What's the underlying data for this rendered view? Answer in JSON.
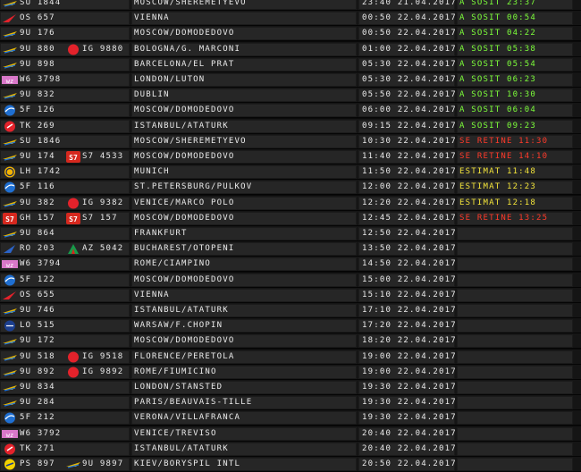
{
  "colors": {
    "green": "#7dff3a",
    "red": "#ff3a2a",
    "yellow": "#f3e43a",
    "text": "#eaeaea"
  },
  "flights": [
    {
      "logo": "airline-wing-logo",
      "code": "SU 1844",
      "share_logo": "",
      "share": "",
      "dest": "MOSCOW/SHEREMETYEVO",
      "time": "23:40",
      "date": "21.04.2017",
      "status": "A SOSIT 23:37",
      "status_color": "green"
    },
    {
      "logo": "airline-red-arrow-logo",
      "code": "OS 657",
      "share_logo": "",
      "share": "",
      "dest": "VIENNA",
      "time": "00:50",
      "date": "22.04.2017",
      "status": "A SOSIT 00:54",
      "status_color": "green"
    },
    {
      "logo": "airline-wing-logo",
      "code": "9U 176",
      "share_logo": "",
      "share": "",
      "dest": "MOSCOW/DOMODEDOVO",
      "time": "00:50",
      "date": "22.04.2017",
      "status": "A SOSIT 04:22",
      "status_color": "green"
    },
    {
      "logo": "airline-wing-logo",
      "code": "9U 880",
      "share_logo": "red-circle-logo",
      "share": "IG 9880",
      "dest": "BOLOGNA/G. MARCONI",
      "time": "01:00",
      "date": "22.04.2017",
      "status": "A SOSIT 05:38",
      "status_color": "green"
    },
    {
      "logo": "airline-wing-logo",
      "code": "9U 898",
      "share_logo": "",
      "share": "",
      "dest": "BARCELONA/EL PRAT",
      "time": "05:30",
      "date": "22.04.2017",
      "status": "A SOSIT 05:54",
      "status_color": "green"
    },
    {
      "logo": "airline-pink-logo",
      "code": "W6 3798",
      "share_logo": "",
      "share": "",
      "dest": "LONDON/LUTON",
      "time": "05:30",
      "date": "22.04.2017",
      "status": "A SOSIT 06:23",
      "status_color": "green"
    },
    {
      "logo": "airline-wing-logo",
      "code": "9U 832",
      "share_logo": "",
      "share": "",
      "dest": "DUBLIN",
      "time": "05:50",
      "date": "22.04.2017",
      "status": "A SOSIT 10:30",
      "status_color": "green"
    },
    {
      "logo": "airline-globe-logo",
      "code": "5F 126",
      "share_logo": "",
      "share": "",
      "dest": "MOSCOW/DOMODEDOVO",
      "time": "06:00",
      "date": "22.04.2017",
      "status": "A SOSIT 06:04",
      "status_color": "green"
    },
    {
      "logo": "airline-turkish-logo",
      "code": "TK 269",
      "share_logo": "",
      "share": "",
      "dest": "ISTANBUL/ATATURK",
      "time": "09:15",
      "date": "22.04.2017",
      "status": "A SOSIT 09:23",
      "status_color": "green"
    },
    {
      "logo": "airline-wing-logo",
      "code": "SU 1846",
      "share_logo": "",
      "share": "",
      "dest": "MOSCOW/SHEREMETYEVO",
      "time": "10:30",
      "date": "22.04.2017",
      "status": "SE RETINE 11:30",
      "status_color": "red"
    },
    {
      "logo": "airline-wing-logo",
      "code": "9U 174",
      "share_logo": "s7-logo",
      "share": "S7 4533",
      "dest": "MOSCOW/DOMODEDOVO",
      "time": "11:40",
      "date": "22.04.2017",
      "status": "SE RETINE 14:10",
      "status_color": "red"
    },
    {
      "logo": "airline-ring-logo",
      "code": "LH 1742",
      "share_logo": "",
      "share": "",
      "dest": "MUNICH",
      "time": "11:50",
      "date": "22.04.2017",
      "status": "ESTIMAT 11:48",
      "status_color": "yellow"
    },
    {
      "logo": "airline-globe-logo",
      "code": "5F 116",
      "share_logo": "",
      "share": "",
      "dest": "ST.PETERSBURG/PULKOV",
      "time": "12:00",
      "date": "22.04.2017",
      "status": "ESTIMAT 12:23",
      "status_color": "yellow"
    },
    {
      "logo": "airline-wing-logo",
      "code": "9U 382",
      "share_logo": "red-circle-logo",
      "share": "IG 9382",
      "dest": "VENICE/MARCO POLO",
      "time": "12:20",
      "date": "22.04.2017",
      "status": "ESTIMAT 12:18",
      "status_color": "yellow"
    },
    {
      "logo": "s7-logo",
      "code": "GH 157",
      "share_logo": "s7-logo",
      "share": "S7 157",
      "dest": "MOSCOW/DOMODEDOVO",
      "time": "12:45",
      "date": "22.04.2017",
      "status": "SE RETINE 13:25",
      "status_color": "red"
    },
    {
      "logo": "airline-wing-logo",
      "code": "9U 864",
      "share_logo": "",
      "share": "",
      "dest": "FRANKFURT",
      "time": "12:50",
      "date": "22.04.2017",
      "status": "",
      "status_color": "green"
    },
    {
      "logo": "airline-tarom-logo",
      "code": "RO 203",
      "share_logo": "alitalia-logo",
      "share": "AZ 5042",
      "dest": "BUCHAREST/OTOPENI",
      "time": "13:50",
      "date": "22.04.2017",
      "status": "",
      "status_color": "green"
    },
    {
      "logo": "airline-pink-logo",
      "code": "W6 3794",
      "share_logo": "",
      "share": "",
      "dest": "ROME/CIAMPINO",
      "time": "14:50",
      "date": "22.04.2017",
      "status": "",
      "status_color": "green"
    },
    {
      "logo": "airline-globe-logo",
      "code": "5F 122",
      "share_logo": "",
      "share": "",
      "dest": "MOSCOW/DOMODEDOVO",
      "time": "15:00",
      "date": "22.04.2017",
      "status": "",
      "status_color": "green"
    },
    {
      "logo": "airline-red-arrow-logo",
      "code": "OS 655",
      "share_logo": "",
      "share": "",
      "dest": "VIENNA",
      "time": "15:10",
      "date": "22.04.2017",
      "status": "",
      "status_color": "green"
    },
    {
      "logo": "airline-wing-logo",
      "code": "9U 746",
      "share_logo": "",
      "share": "",
      "dest": "ISTANBUL/ATATURK",
      "time": "17:10",
      "date": "22.04.2017",
      "status": "",
      "status_color": "green"
    },
    {
      "logo": "airline-lot-logo",
      "code": "LO 515",
      "share_logo": "",
      "share": "",
      "dest": "WARSAW/F.CHOPIN",
      "time": "17:20",
      "date": "22.04.2017",
      "status": "",
      "status_color": "green"
    },
    {
      "logo": "airline-wing-logo",
      "code": "9U 172",
      "share_logo": "",
      "share": "",
      "dest": "MOSCOW/DOMODEDOVO",
      "time": "18:20",
      "date": "22.04.2017",
      "status": "",
      "status_color": "green"
    },
    {
      "logo": "airline-wing-logo",
      "code": "9U 518",
      "share_logo": "red-circle-logo",
      "share": "IG 9518",
      "dest": "FLORENCE/PERETOLA",
      "time": "19:00",
      "date": "22.04.2017",
      "status": "",
      "status_color": "green"
    },
    {
      "logo": "airline-wing-logo",
      "code": "9U 892",
      "share_logo": "red-circle-logo",
      "share": "IG 9892",
      "dest": "ROME/FIUMICINO",
      "time": "19:00",
      "date": "22.04.2017",
      "status": "",
      "status_color": "green"
    },
    {
      "logo": "airline-wing-logo",
      "code": "9U 834",
      "share_logo": "",
      "share": "",
      "dest": "LONDON/STANSTED",
      "time": "19:30",
      "date": "22.04.2017",
      "status": "",
      "status_color": "green"
    },
    {
      "logo": "airline-wing-logo",
      "code": "9U 284",
      "share_logo": "",
      "share": "",
      "dest": "PARIS/BEAUVAIS-TILLE",
      "time": "19:30",
      "date": "22.04.2017",
      "status": "",
      "status_color": "green"
    },
    {
      "logo": "airline-globe-logo",
      "code": "5F 212",
      "share_logo": "",
      "share": "",
      "dest": "VERONA/VILLAFRANCA",
      "time": "19:30",
      "date": "22.04.2017",
      "status": "",
      "status_color": "green"
    },
    {
      "logo": "airline-pink-logo",
      "code": "W6 3792",
      "share_logo": "",
      "share": "",
      "dest": "VENICE/TREVISO",
      "time": "20:40",
      "date": "22.04.2017",
      "status": "",
      "status_color": "green"
    },
    {
      "logo": "airline-turkish-logo",
      "code": "TK 271",
      "share_logo": "",
      "share": "",
      "dest": "ISTANBUL/ATATURK",
      "time": "20:40",
      "date": "22.04.2017",
      "status": "",
      "status_color": "green"
    },
    {
      "logo": "airline-ukraine-logo",
      "code": "PS 897",
      "share_logo": "airline-wing-logo",
      "share": "9U 9897",
      "dest": "KIEV/BORYSPIL INTL",
      "time": "20:50",
      "date": "22.04.2017",
      "status": "",
      "status_color": "green"
    }
  ]
}
